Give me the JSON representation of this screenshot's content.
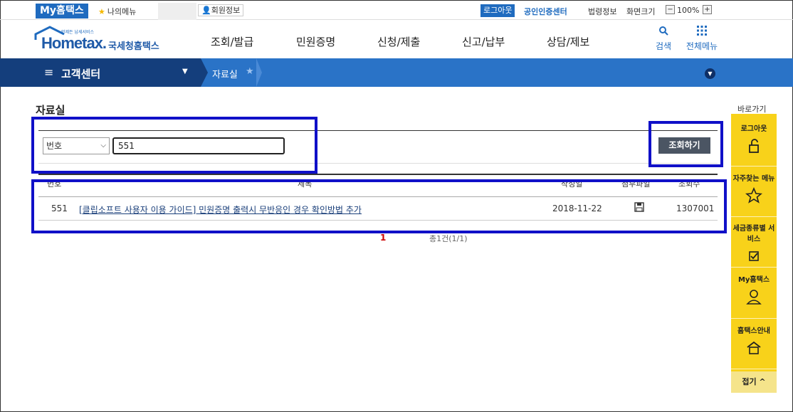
{
  "topbar": {
    "my_hometax": "My홈택스",
    "my_menu": "나의메뉴",
    "member_info": "회원정보",
    "logout": "로그아웃",
    "cert_center": "공인인증센터",
    "legal_info": "법령정보",
    "screen_size": "화면크기",
    "zoom_minus": "−",
    "zoom_level": "100%",
    "zoom_plus": "+"
  },
  "header": {
    "logo_sub": "언제든 납세서비스",
    "logo_main": "Hometax.",
    "logo_kr": "국세청홈택스",
    "nav": [
      "조회/발급",
      "민원증명",
      "신청/제출",
      "신고/납부",
      "상담/제보"
    ],
    "search_label": "검색",
    "all_menu_label": "전체메뉴"
  },
  "location": {
    "section": "고객센터",
    "page": "자료실"
  },
  "main": {
    "title": "자료실",
    "search": {
      "field_selected": "번호",
      "query": "551",
      "button": "조회하기"
    },
    "table": {
      "headers": [
        "번호",
        "제목",
        "작성일",
        "첨부파일",
        "조회수"
      ],
      "rows": [
        {
          "no": "551",
          "title": "[클립소프트 사용자 이용 가이드] 민원증명 출력시 무반응인 경우 확인방법 추가",
          "date": "2018-11-22",
          "attachment_icon": "floppy-disk-icon",
          "views": "1307001"
        }
      ]
    },
    "pagination": {
      "current": "1",
      "info": "총1건(1/1)"
    }
  },
  "quick_menu": {
    "title": "바로가기",
    "items": [
      {
        "label": "로그아웃",
        "icon": "lock-icon"
      },
      {
        "label": "자주찾는 메뉴",
        "icon": "star-icon"
      },
      {
        "label": "세금종류별 서비스",
        "icon": "checkbox-icon"
      },
      {
        "label": "My홈택스",
        "icon": "user-icon"
      },
      {
        "label": "홈택스안내",
        "icon": "guide-icon"
      }
    ],
    "fold": "접기 ^"
  },
  "colors": {
    "brand_blue": "#1f6bbf",
    "nav_dark": "#143e7c",
    "quick_yellow": "#f8d21a",
    "annotation_blue": "#1010c8"
  }
}
